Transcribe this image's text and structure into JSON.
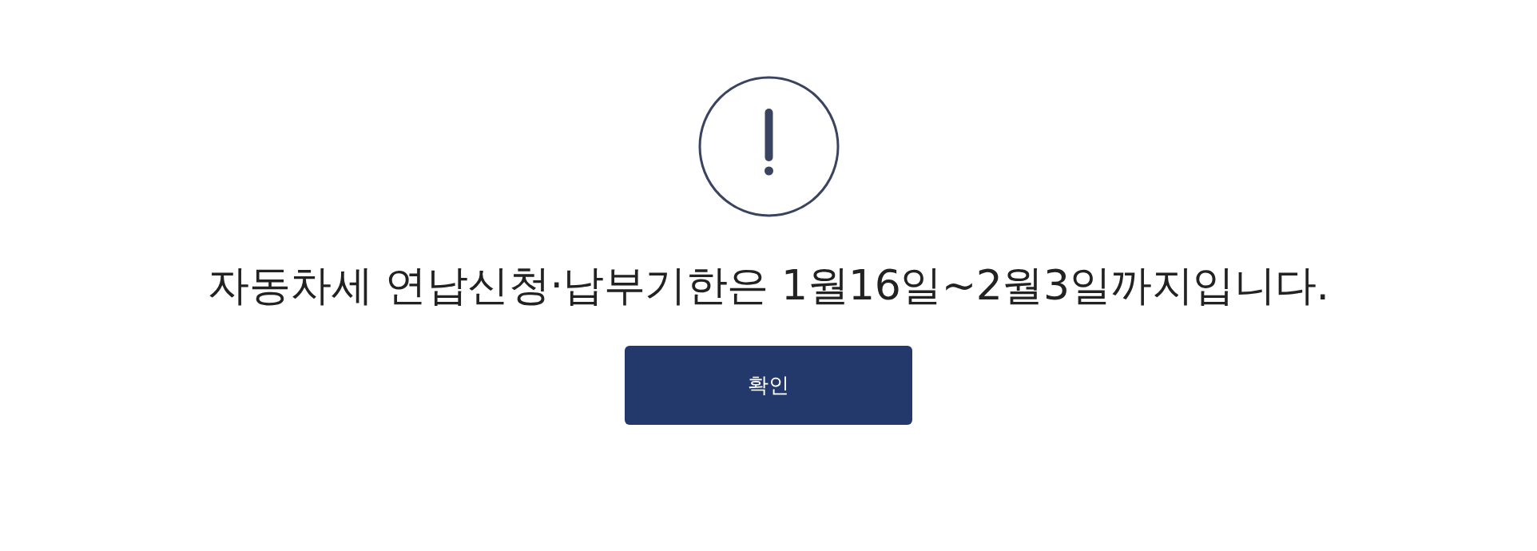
{
  "dialog": {
    "message": "자동차세 연납신청·납부기한은 1월16일~2월3일까지입니다.",
    "buttons": [
      {
        "label": "확인"
      }
    ]
  }
}
